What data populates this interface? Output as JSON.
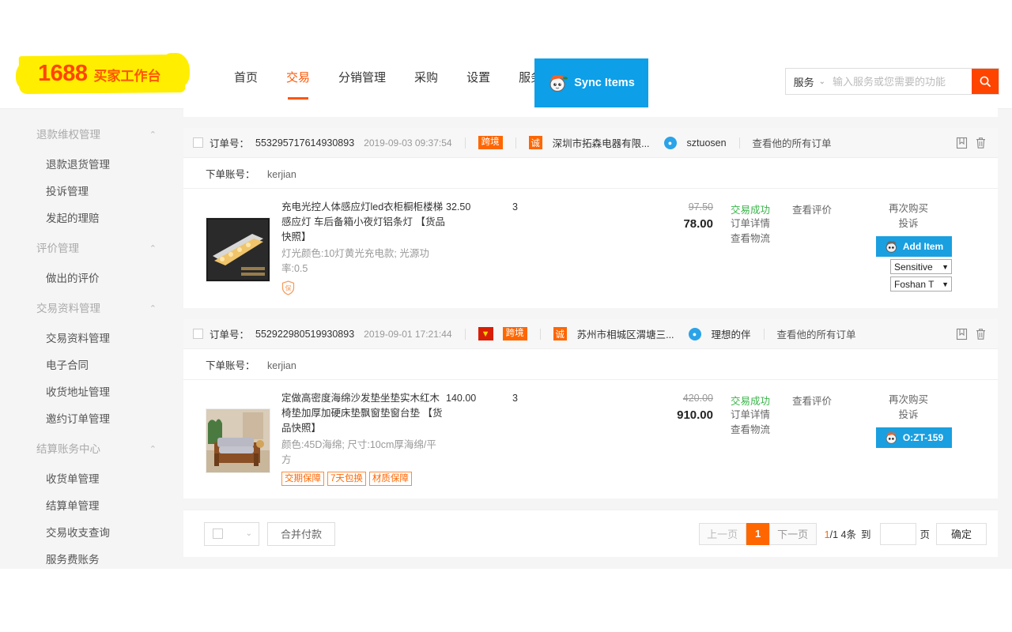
{
  "header": {
    "logo": {
      "brand": "1688",
      "suffix": "买家工作台",
      "highlight_color": "#ffee00",
      "brand_color": "#ff4400"
    },
    "nav": [
      {
        "label": "首页",
        "active": false
      },
      {
        "label": "交易",
        "active": true
      },
      {
        "label": "分销管理",
        "active": false
      },
      {
        "label": "采购",
        "active": false
      },
      {
        "label": "设置",
        "active": false
      },
      {
        "label": "服务",
        "active": false,
        "caret": "⌄"
      }
    ],
    "sync_button": {
      "label": "Sync Items",
      "color": "#0d9fe8"
    },
    "search": {
      "scope_label": "服务",
      "caret": "⌄",
      "placeholder": "输入服务或您需要的功能",
      "value": "",
      "button_color": "#ff4400"
    }
  },
  "sidebar": {
    "groups": [
      {
        "label": "退款维权管理",
        "items": [
          "退款退货管理",
          "投诉管理",
          "发起的理赔"
        ]
      },
      {
        "label": "评价管理",
        "items": [
          "做出的评价"
        ]
      },
      {
        "label": "交易资料管理",
        "items": [
          "交易资料管理",
          "电子合同",
          "收货地址管理",
          "邀约订单管理"
        ]
      },
      {
        "label": "结算账务中心",
        "items": [
          "收货单管理",
          "结算单管理",
          "交易收支查询",
          "服务费账务"
        ]
      }
    ]
  },
  "orders": [
    {
      "order_label": "订单号：",
      "order_id": "553295717614930893",
      "datetime": "2019-09-03 09:37:54",
      "badges": {
        "crown": false,
        "cross_border": "跨境",
        "credit": "诚"
      },
      "company": "深圳市拓森电器有限...",
      "im_user": "sztuosen",
      "view_all_link": "查看他的所有订单",
      "account_label": "下单账号：",
      "account_value": "kerjian",
      "product": {
        "title": "充电光控人体感应灯led衣柜橱柜楼梯感应灯 车后备箱小夜灯铝条灯 【货品快照】",
        "attrs": "灯光颜色:10灯黄光充电款; 光源功率:0.5",
        "tags": [],
        "shield_tag": "保"
      },
      "unit_price": "32.50",
      "quantity": "3",
      "total_original": "97.50",
      "total_final": "78.00",
      "status": "交易成功",
      "status_links": [
        "订单详情",
        "查看物流"
      ],
      "evaluate_link": "查看评价",
      "ops": [
        "再次购买",
        "投诉"
      ],
      "extension": {
        "add_button": "Add Item",
        "select_1": "Sensitive",
        "select_2": "Foshan T"
      }
    },
    {
      "order_label": "订单号：",
      "order_id": "552922980519930893",
      "datetime": "2019-09-01 17:21:44",
      "badges": {
        "crown": true,
        "cross_border": "跨境",
        "credit": "诚"
      },
      "company": "苏州市相城区渭塘三...",
      "im_user": "理想的伴",
      "view_all_link": "查看他的所有订单",
      "account_label": "下单账号：",
      "account_value": "kerjian",
      "product": {
        "title": "定做高密度海绵沙发垫坐垫实木红木椅垫加厚加硬床垫飘窗垫窗台垫 【货品快照】",
        "attrs": "颜色:45D海绵; 尺寸:10cm厚海绵/平方",
        "tags": [
          "交期保障",
          "7天包换",
          "材质保障"
        ],
        "shield_tag": ""
      },
      "unit_price": "140.00",
      "quantity": "3",
      "total_original": "420.00",
      "total_final": "910.00",
      "status": "交易成功",
      "status_links": [
        "订单详情",
        "查看物流"
      ],
      "evaluate_link": "查看评价",
      "ops": [
        "再次购买",
        "投诉"
      ],
      "extension": {
        "add_button": "O:ZT-159"
      }
    }
  ],
  "footer": {
    "select_all_caret": "⌄",
    "merge_pay_label": "合并付款",
    "pagination": {
      "prev": "上一页",
      "current": "1",
      "next": "下一页",
      "info_current": "1",
      "info_rest": "/1 4条",
      "goto_label": "到",
      "goto_value": "",
      "page_unit": "页",
      "confirm": "确定",
      "active_color": "#ff6600"
    }
  }
}
